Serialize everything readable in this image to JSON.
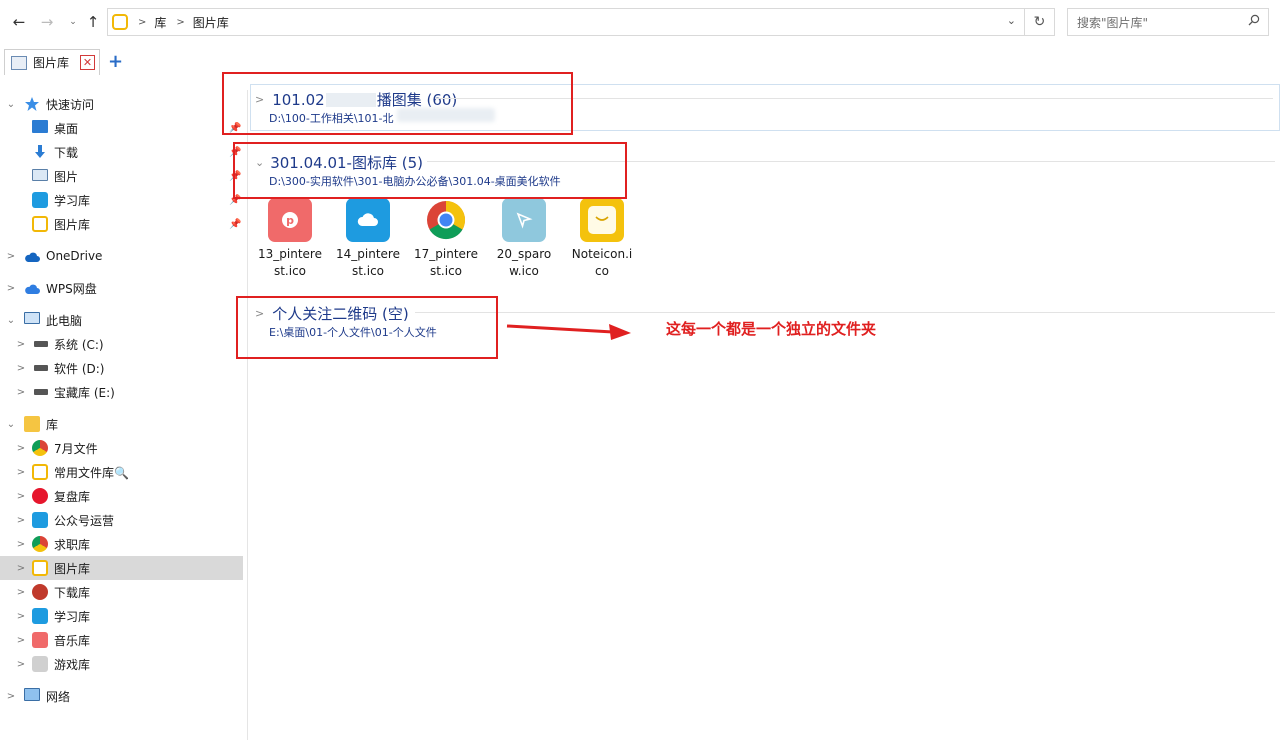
{
  "address": {
    "crumbs": [
      "库",
      "图片库"
    ],
    "search_placeholder": "搜索\"图片库\""
  },
  "tab": {
    "label": "图片库",
    "close": "✕",
    "add": "+"
  },
  "sidebar": {
    "items": [
      {
        "label": "快速访问"
      },
      {
        "label": "桌面"
      },
      {
        "label": "下载"
      },
      {
        "label": "图片"
      },
      {
        "label": "学习库"
      },
      {
        "label": "图片库"
      },
      {
        "label": "OneDrive"
      },
      {
        "label": "WPS网盘"
      },
      {
        "label": "此电脑"
      },
      {
        "label": "系统 (C:)"
      },
      {
        "label": "软件 (D:)"
      },
      {
        "label": "宝藏库 (E:)"
      },
      {
        "label": "库"
      },
      {
        "label": "7月文件"
      },
      {
        "label": "常用文件库🔍"
      },
      {
        "label": "复盘库"
      },
      {
        "label": "公众号运营"
      },
      {
        "label": "求职库"
      },
      {
        "label": "图片库"
      },
      {
        "label": "下载库"
      },
      {
        "label": "学习库"
      },
      {
        "label": "音乐库"
      },
      {
        "label": "游戏库"
      },
      {
        "label": "网络"
      }
    ]
  },
  "groups": [
    {
      "title_a": "101.02",
      "title_b": "播图集 (60)",
      "path": "D:\\100-工作相关\\101-北",
      "expanded": false
    },
    {
      "title": "301.04.01-图标库 (5)",
      "path": "D:\\300-实用软件\\301-电脑办公必备\\301.04-桌面美化软件",
      "expanded": true
    },
    {
      "title": "个人关注二维码 (空)",
      "path": "E:\\桌面\\01-个人文件\\01-个人文件",
      "expanded": false
    }
  ],
  "files": [
    {
      "name_1": "13_pintere",
      "name_2": "st.ico",
      "icon": "pinterest-icon",
      "color": "#f06a6a"
    },
    {
      "name_1": "14_pintere",
      "name_2": "st.ico",
      "icon": "cloud-icon",
      "color": "#1e9be0"
    },
    {
      "name_1": "17_pintere",
      "name_2": "st.ico",
      "icon": "chrome-icon",
      "color": "#4285f4"
    },
    {
      "name_1": "20_sparo",
      "name_2": "w.ico",
      "icon": "sparrow-icon",
      "color": "#8fc8dd"
    },
    {
      "name_1": "Noteicon.i",
      "name_2": "co",
      "icon": "note-icon",
      "color": "#f4c20d"
    }
  ],
  "annotation": {
    "text": "这每一个都是一个独立的文件夹",
    "color": "#e02020"
  }
}
